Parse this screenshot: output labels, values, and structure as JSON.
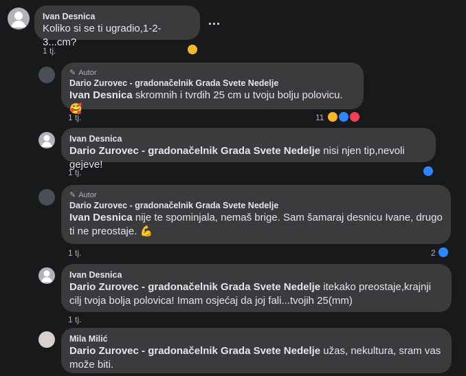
{
  "comments": [
    {
      "author": "Ivan Desnica",
      "segments": [
        {
          "text": "Koliko si se ti ugradio,1-2-3...cm?",
          "bold": false
        }
      ],
      "time": "1 tj.",
      "reactions": [
        "haha"
      ],
      "count": ""
    },
    {
      "badge": "Autor",
      "author": "Dario Zurovec - gradonačelnik Grada Svete Nedelje",
      "segments": [
        {
          "text": "Ivan Desnica",
          "bold": true
        },
        {
          "text": " skromnih i tvrdih 25 cm u tvoju bolju polovicu. 🥰",
          "bold": false
        }
      ],
      "time": "1 tj.",
      "reactions": [
        "haha",
        "like",
        "love"
      ],
      "count": "11"
    },
    {
      "author": "Ivan Desnica",
      "segments": [
        {
          "text": "Dario Zurovec - gradonačelnik Grada Svete Nedelje",
          "bold": true
        },
        {
          "text": " nisi njen tip,nevoli gejeve!",
          "bold": false
        }
      ],
      "time": "1 tj.",
      "reactions": [
        "like"
      ],
      "count": ""
    },
    {
      "badge": "Autor",
      "author": "Dario Zurovec - gradonačelnik Grada Svete Nedelje",
      "segments": [
        {
          "text": "Ivan Desnica",
          "bold": true
        },
        {
          "text": " nije te spominjala, nemaš brige. Sam šamaraj desnicu Ivane, drugo ti ne preostaje. 💪",
          "bold": false
        }
      ],
      "time": "1 tj.",
      "reactions": [
        "like"
      ],
      "count": "2"
    },
    {
      "author": "Ivan Desnica",
      "segments": [
        {
          "text": "Dario Zurovec - gradonačelnik Grada Svete Nedelje",
          "bold": true
        },
        {
          "text": " itekako preostaje,krajnji cilj tvoja bolja polovica! Imam osjećaj da joj fali...tvojih 25(mm)",
          "bold": false
        }
      ],
      "time": "1 tj.",
      "reactions": [],
      "count": ""
    },
    {
      "author": "Mila Milić",
      "segments": [
        {
          "text": "Dario Zurovec - gradonačelnik Grada Svete Nedelje",
          "bold": true
        },
        {
          "text": " užas, nekultura, sram vas može biti.",
          "bold": false
        }
      ],
      "time": "",
      "reactions": [],
      "count": ""
    }
  ],
  "more_options": "...",
  "colors": {
    "background": "#18191a",
    "bubble": "#3a3b3c",
    "like": "#2d88ff",
    "haha": "#f7b928",
    "love": "#f33e58"
  }
}
